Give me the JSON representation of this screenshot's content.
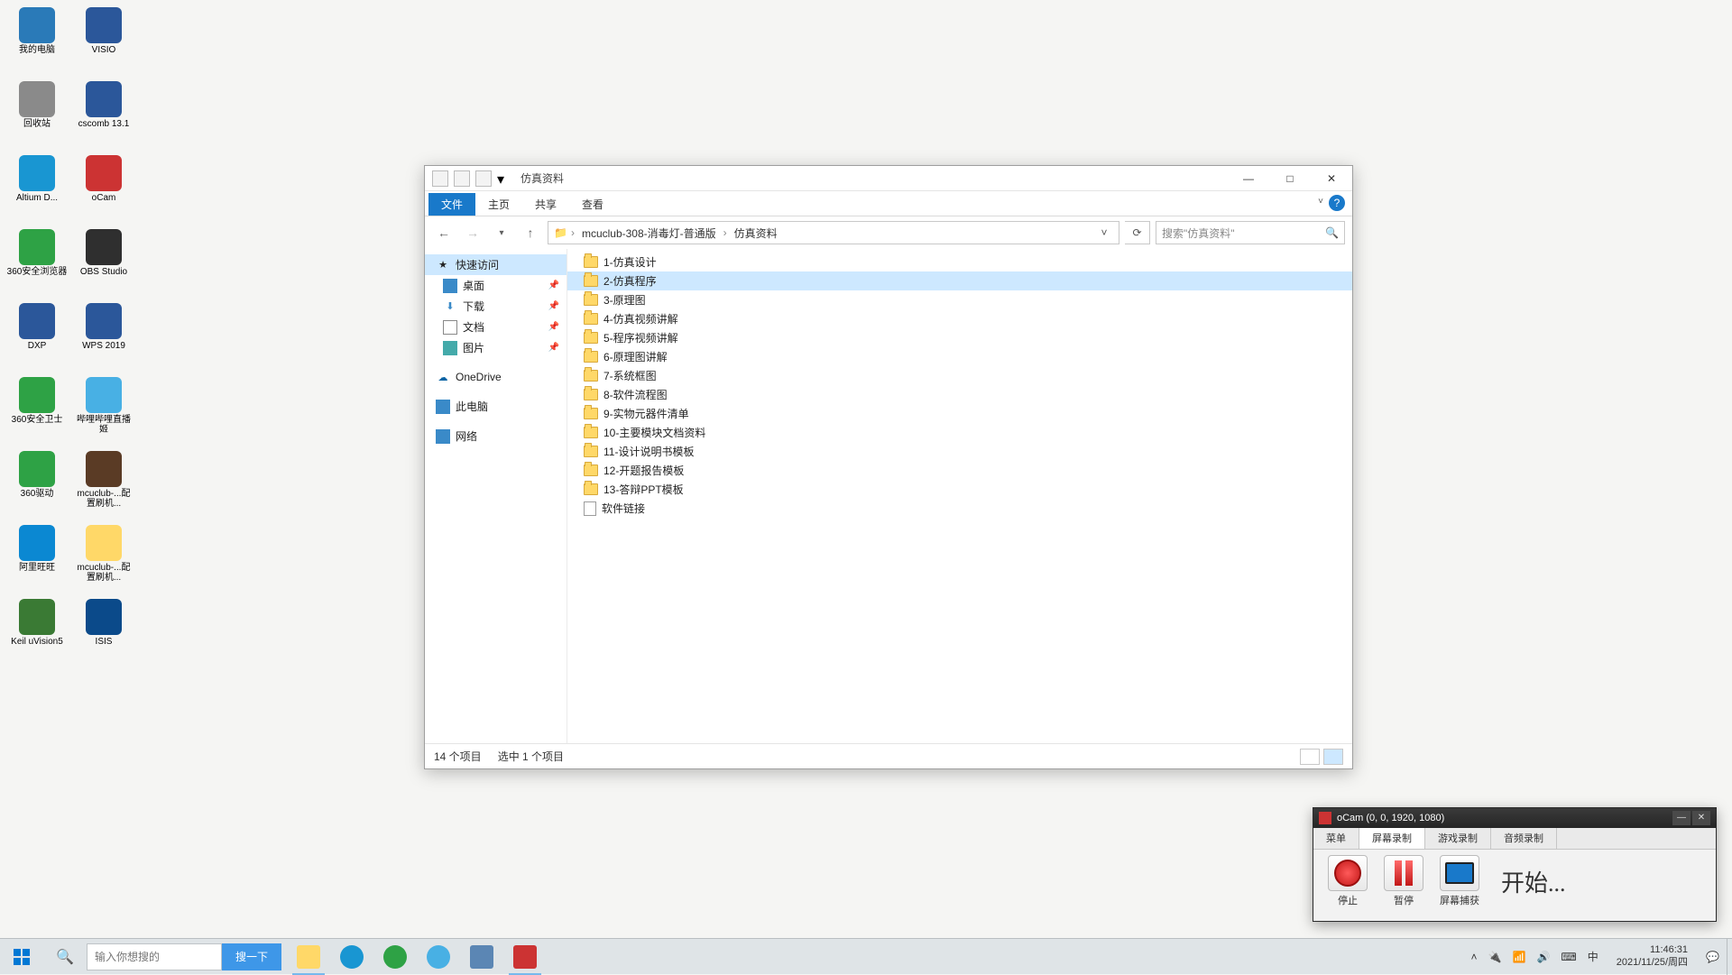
{
  "desktop": {
    "icons": [
      {
        "label": "我的电脑",
        "color": "#2a7ab8"
      },
      {
        "label": "VISIO",
        "color": "#2b579a"
      },
      {
        "label": "回收站",
        "color": "#8a8a8a"
      },
      {
        "label": "cscomb 13.1",
        "color": "#2b579a"
      },
      {
        "label": "Altium D...",
        "color": "#1996d2"
      },
      {
        "label": "oCam",
        "color": "#c33"
      },
      {
        "label": "360安全浏览器",
        "color": "#2ea245"
      },
      {
        "label": "OBS Studio",
        "color": "#2f2f2f"
      },
      {
        "label": "DXP",
        "color": "#2b579a"
      },
      {
        "label": "WPS 2019",
        "color": "#2b579a"
      },
      {
        "label": "360安全卫士",
        "color": "#2ea245"
      },
      {
        "label": "哔哩哔哩直播姬",
        "color": "#48b0e4"
      },
      {
        "label": "360驱动",
        "color": "#2ea245"
      },
      {
        "label": "mcuclub-...配置刷机...",
        "color": "#5a3b25"
      },
      {
        "label": "阿里旺旺",
        "color": "#0b88d2"
      },
      {
        "label": "mcuclub-...配置刷机...",
        "color": "#ffd868"
      },
      {
        "label": "Keil uVision5",
        "color": "#3a7a34"
      },
      {
        "label": "ISIS",
        "color": "#0b4a8a"
      }
    ]
  },
  "explorer": {
    "title": "仿真资料",
    "tabs": {
      "file": "文件",
      "home": "主页",
      "share": "共享",
      "view": "查看"
    },
    "breadcrumb": {
      "a": "mcuclub-308-消毒灯-普通版",
      "b": "仿真资料"
    },
    "search_placeholder": "搜索\"仿真资料\"",
    "nav": {
      "quick": "快速访问",
      "desktop": "桌面",
      "downloads": "下载",
      "documents": "文档",
      "pictures": "图片",
      "onedrive": "OneDrive",
      "thispc": "此电脑",
      "network": "网络"
    },
    "items": [
      "1-仿真设计",
      "2-仿真程序",
      "3-原理图",
      "4-仿真视频讲解",
      "5-程序视频讲解",
      "6-原理图讲解",
      "7-系统框图",
      "8-软件流程图",
      "9-实物元器件清单",
      "10-主要模块文档资料",
      "11-设计说明书模板",
      "12-开题报告模板",
      "13-答辩PPT模板"
    ],
    "file_item": "软件链接",
    "selected_index": 1,
    "status": {
      "count": "14 个项目",
      "sel": "选中 1 个项目"
    }
  },
  "ocam": {
    "title": "oCam (0, 0, 1920, 1080)",
    "tabs": {
      "menu": "菜单",
      "screen": "屏幕录制",
      "game": "游戏录制",
      "audio": "音频录制"
    },
    "btns": {
      "stop": "停止",
      "pause": "暂停",
      "capture": "屏幕捕获"
    },
    "status": "开始..."
  },
  "taskbar": {
    "search_placeholder": "输入你想搜的",
    "search_btn": "搜一下",
    "ime": "中",
    "time": "11:46:31",
    "date": "2021/11/25/周四"
  }
}
